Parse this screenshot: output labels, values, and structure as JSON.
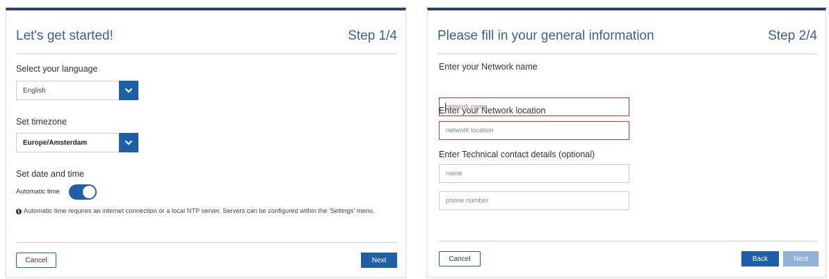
{
  "step1": {
    "title": "Let's get started!",
    "step": "Step 1/4",
    "language_label": "Select your language",
    "language_value": "English",
    "timezone_label": "Set timezone",
    "timezone_value": "Europe/Amsterdam",
    "datetime_label": "Set date and time",
    "auto_time_label": "Automatic time",
    "auto_time_on": true,
    "note": "Automatic time requires an internet connection or a local NTP server. Servers can be configured within the 'Settings' menu.",
    "cancel_label": "Cancel",
    "next_label": "Next"
  },
  "step2": {
    "title": "Please fill in your general information",
    "step": "Step 2/4",
    "network_name_label": "Enter your Network name",
    "network_name_placeholder": "network name",
    "network_location_label": "Enter your Network location",
    "network_location_placeholder": "network location",
    "technical_contact_label": "Enter Technical contact details (optional)",
    "contact_name_placeholder": "name",
    "contact_phone_placeholder": "phone number",
    "cancel_label": "Cancel",
    "back_label": "Back",
    "next_label": "Next"
  },
  "colors": {
    "accent": "#1d5fa8",
    "title": "#3d5f8a",
    "top_bar": "#2c3e6b",
    "error_border": "#c0393b",
    "disabled_button": "#8fb2d8"
  },
  "icons": {
    "dropdown": "chevron-down-icon",
    "info": "info-icon"
  }
}
